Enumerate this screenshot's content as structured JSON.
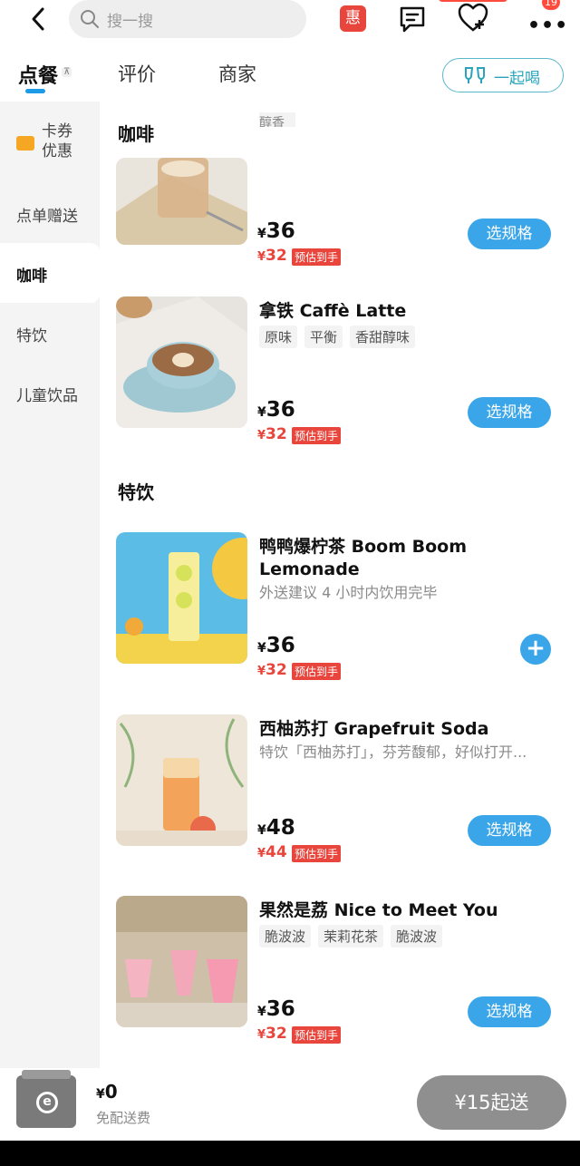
{
  "header": {
    "search_placeholder": "搜一搜",
    "promo_badge": "惠",
    "more_badge_count": "19"
  },
  "tabs": [
    {
      "label": "点餐"
    },
    {
      "label": "评价"
    },
    {
      "label": "商家"
    }
  ],
  "together_button": "一起喝",
  "sidebar": {
    "items": [
      {
        "label": "卡券\n优惠"
      },
      {
        "label": "点单赠送"
      },
      {
        "label": "咖啡"
      },
      {
        "label": "特饮"
      },
      {
        "label": "儿童饮品"
      }
    ],
    "active": "咖啡"
  },
  "sections": [
    {
      "title": "咖啡",
      "items": [
        {
          "name": "",
          "tags": [],
          "desc": "",
          "price": "36",
          "discount_price": "32",
          "discount_tag": "预估到手",
          "action": "选规格"
        },
        {
          "name": "拿铁 Caffè Latte",
          "tags": [
            "原味",
            "平衡",
            "香甜醇味"
          ],
          "desc": "",
          "price": "36",
          "discount_price": "32",
          "discount_tag": "预估到手",
          "action": "选规格"
        }
      ]
    },
    {
      "title": "特饮",
      "items": [
        {
          "name": "鸭鸭爆柠茶 Boom Boom Lemonade",
          "tags": [],
          "desc": "外送建议 4 小时内饮用完毕",
          "price": "36",
          "discount_price": "32",
          "discount_tag": "预估到手",
          "action": "+"
        },
        {
          "name": "西柚苏打 Grapefruit Soda",
          "tags": [],
          "desc": "特饮「西柚苏打」，芬芳馥郁，好似打开...",
          "price": "48",
          "discount_price": "44",
          "discount_tag": "预估到手",
          "action": "选规格"
        },
        {
          "name": "果然是荔 Nice to Meet You",
          "tags": [
            "脆波波",
            "茉莉花茶",
            "脆波波"
          ],
          "desc": "",
          "price": "36",
          "discount_price": "32",
          "discount_tag": "预估到手",
          "action": "选规格"
        }
      ]
    }
  ],
  "cart": {
    "total": "0",
    "delivery_fee_note": "免配送费",
    "checkout_label": "¥15起送"
  },
  "currency": "¥",
  "colors": {
    "accent": "#3aa5e8",
    "discount": "#e8453c",
    "teal": "#2aa4bc"
  }
}
